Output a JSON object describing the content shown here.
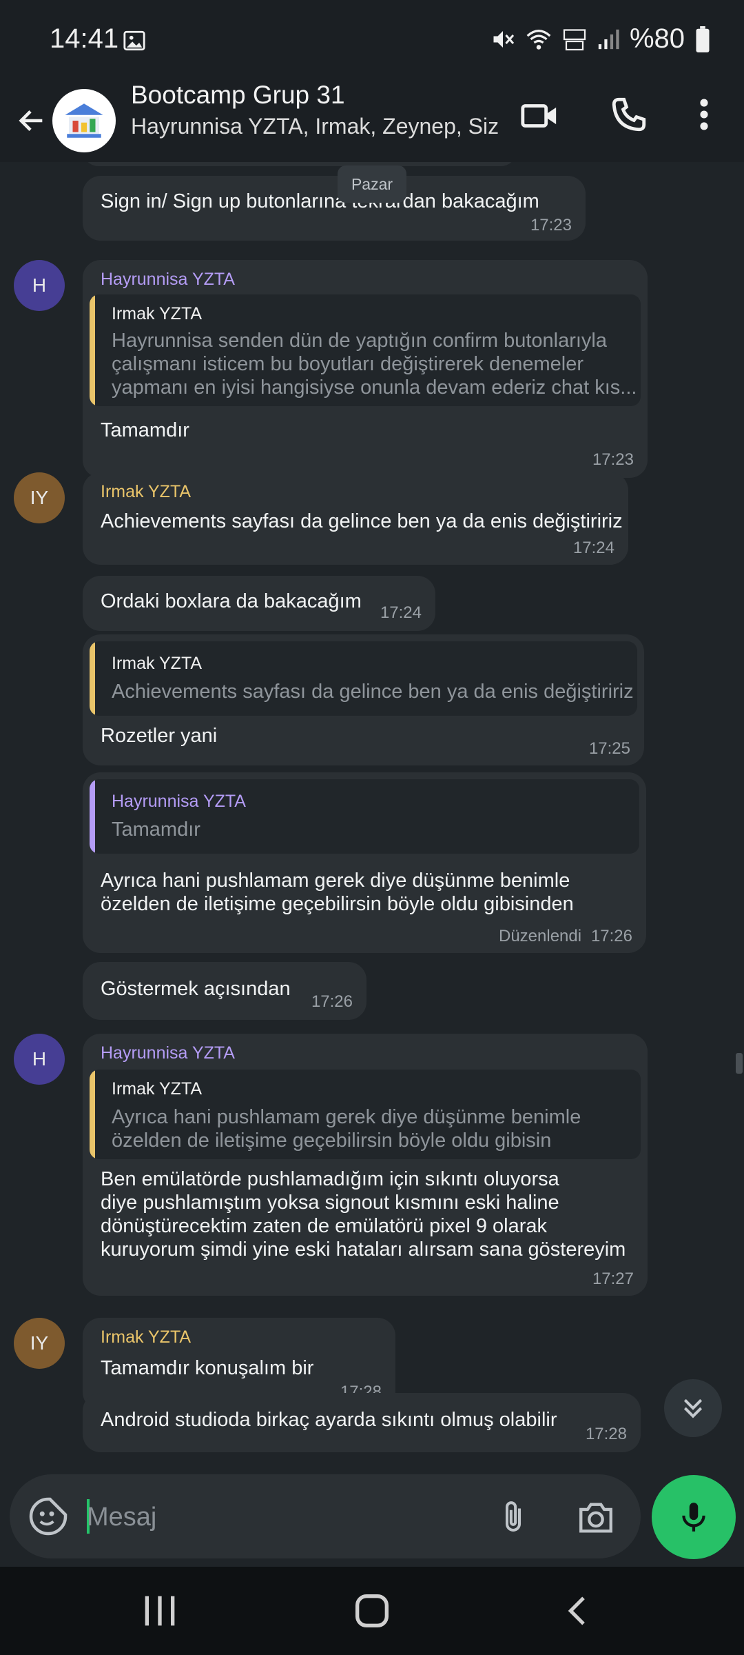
{
  "status_bar": {
    "time": "14:41",
    "battery": "%80"
  },
  "header": {
    "title": "Bootcamp Grup 31",
    "members": "Hayrunnisa YZTA, Irmak, Zeynep, Siz"
  },
  "date_chip": "Pazar",
  "messages": {
    "m1": {
      "text": "Sign in/ Sign up butonlarına tekrardan bakacağım",
      "time": "17:23"
    },
    "m2": {
      "sender": "Hayrunnisa YZTA",
      "avatar": "H",
      "quote_sender": "Irmak YZTA",
      "quote_lines": [
        "Hayrunnisa senden dün de yaptığın confirm butonlarıyla",
        "çalışmanı isticem bu boyutları değiştirerek denemeler",
        "yapmanı en iyisi hangisiyse onunla devam ederiz chat kıs..."
      ],
      "text": "Tamamdır",
      "time": "17:23"
    },
    "m3": {
      "sender": "Irmak YZTA",
      "avatar": "IY",
      "text": "Achievements sayfası da gelince ben ya da enis değiştiririz",
      "time": "17:24"
    },
    "m4": {
      "text": "Ordaki boxlara da bakacağım",
      "time": "17:24"
    },
    "m5": {
      "quote_sender": "Irmak YZTA",
      "quote_text": "Achievements sayfası da gelince ben ya da enis değiştiririz",
      "text": "Rozetler yani",
      "time": "17:25"
    },
    "m6": {
      "quote_sender": "Hayrunnisa YZTA",
      "quote_text": "Tamamdır",
      "lines": [
        "Ayrıca hani pushlamam gerek diye düşünme benimle",
        "özelden de iletişime geçebilirsin böyle oldu gibisinden"
      ],
      "edited": "Düzenlendi",
      "time": "17:26"
    },
    "m7": {
      "text": "Göstermek açısından",
      "time": "17:26"
    },
    "m8": {
      "sender": "Hayrunnisa YZTA",
      "avatar": "H",
      "quote_sender": "Irmak YZTA",
      "quote_lines": [
        "Ayrıca hani pushlamam gerek diye düşünme benimle",
        "özelden de iletişime geçebilirsin böyle oldu gibisin"
      ],
      "lines": [
        "Ben emülatörde pushlamadığım için sıkıntı oluyorsa",
        "diye pushlamıştım yoksa signout kısmını eski haline",
        "dönüştürecektim zaten de emülatörü pixel 9 olarak",
        "kuruyorum şimdi yine eski hataları alırsam sana göstereyim"
      ],
      "time": "17:27"
    },
    "m9": {
      "sender": "Irmak YZTA",
      "avatar": "IY",
      "text": "Tamamdır konuşalım bir",
      "time": "17:28"
    },
    "m10": {
      "text": "Android studioda birkaç ayarda sıkıntı olmuş olabilir",
      "time": "17:28"
    }
  },
  "composer": {
    "placeholder": "Mesaj"
  },
  "colors": {
    "background": "#1f2428",
    "bubble": "#2b3034",
    "irmak_name": "#e9c46a",
    "hayrunnisa_name": "#b49cf5",
    "send_button": "#27c167"
  },
  "icons": [
    "image-icon",
    "mute-icon",
    "wifi-icon",
    "volte-icon",
    "signal-icon",
    "battery-icon",
    "back-arrow-icon",
    "group-avatar-icon",
    "video-call-icon",
    "phone-icon",
    "more-vert-icon",
    "sticker-icon",
    "attach-icon",
    "camera-icon",
    "mic-icon",
    "scroll-down-icon",
    "recent-apps-icon",
    "home-icon",
    "nav-back-icon"
  ]
}
